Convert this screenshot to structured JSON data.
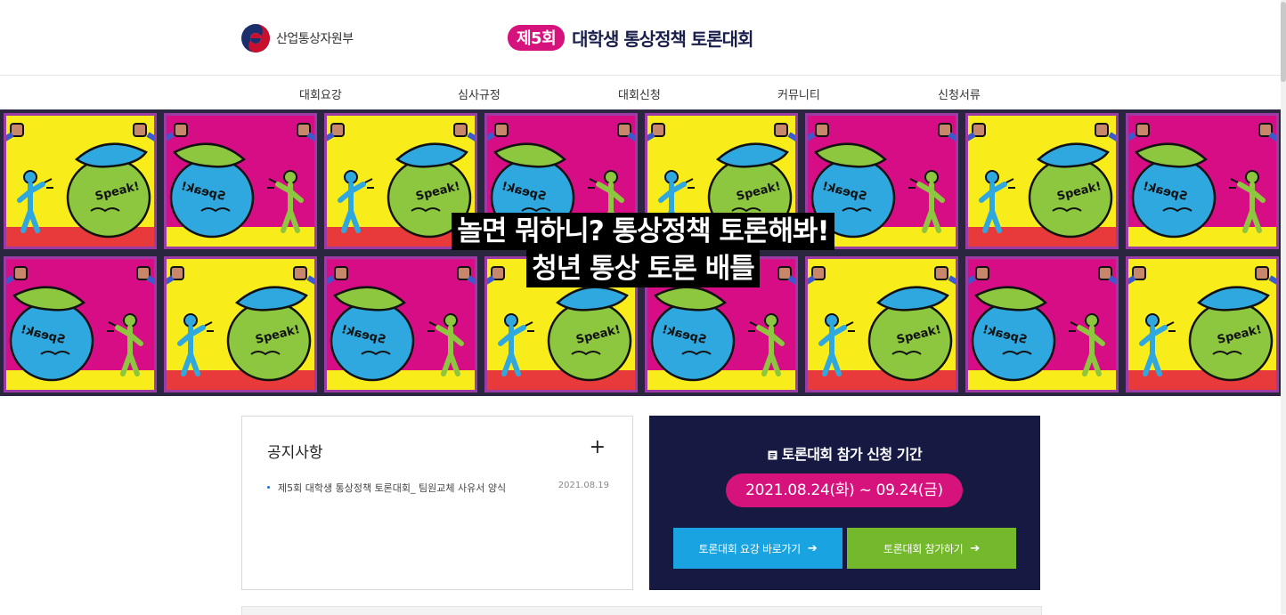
{
  "header": {
    "ministry_name": "산업통상자원부",
    "event_badge": "제5회",
    "event_name": "대학생 통상정책 토론대회"
  },
  "nav": {
    "items": [
      {
        "label": "대회요강"
      },
      {
        "label": "심사규정"
      },
      {
        "label": "대회신청"
      },
      {
        "label": "커뮤니티"
      },
      {
        "label": "신청서류"
      }
    ]
  },
  "banner": {
    "line1": "놀면 뭐하니? 통상정책 토론해봐!",
    "line2": "청년 통상 토론 배틀",
    "speech_text": "Speak!",
    "colors": {
      "yellow": "#f8ec1a",
      "magenta": "#d70d85",
      "green": "#8dc63f",
      "blue": "#2fa8e0",
      "frame": "#2b2640"
    }
  },
  "notice": {
    "title": "공지사항",
    "more_icon": "plus-icon",
    "items": [
      {
        "text": "제5회 대학생 통상정책 토론대회_ 팀원교체 사유서 양식",
        "date": "2021.08.19"
      }
    ]
  },
  "period": {
    "icon": "document-icon",
    "title": "토론대회 참가 신청 기간",
    "date_range": "2021.08.24(화) ~ 09.24(금)",
    "buttons": {
      "guide": "토론대회 요강 바로가기",
      "apply": "토론대회 참가하기"
    }
  }
}
